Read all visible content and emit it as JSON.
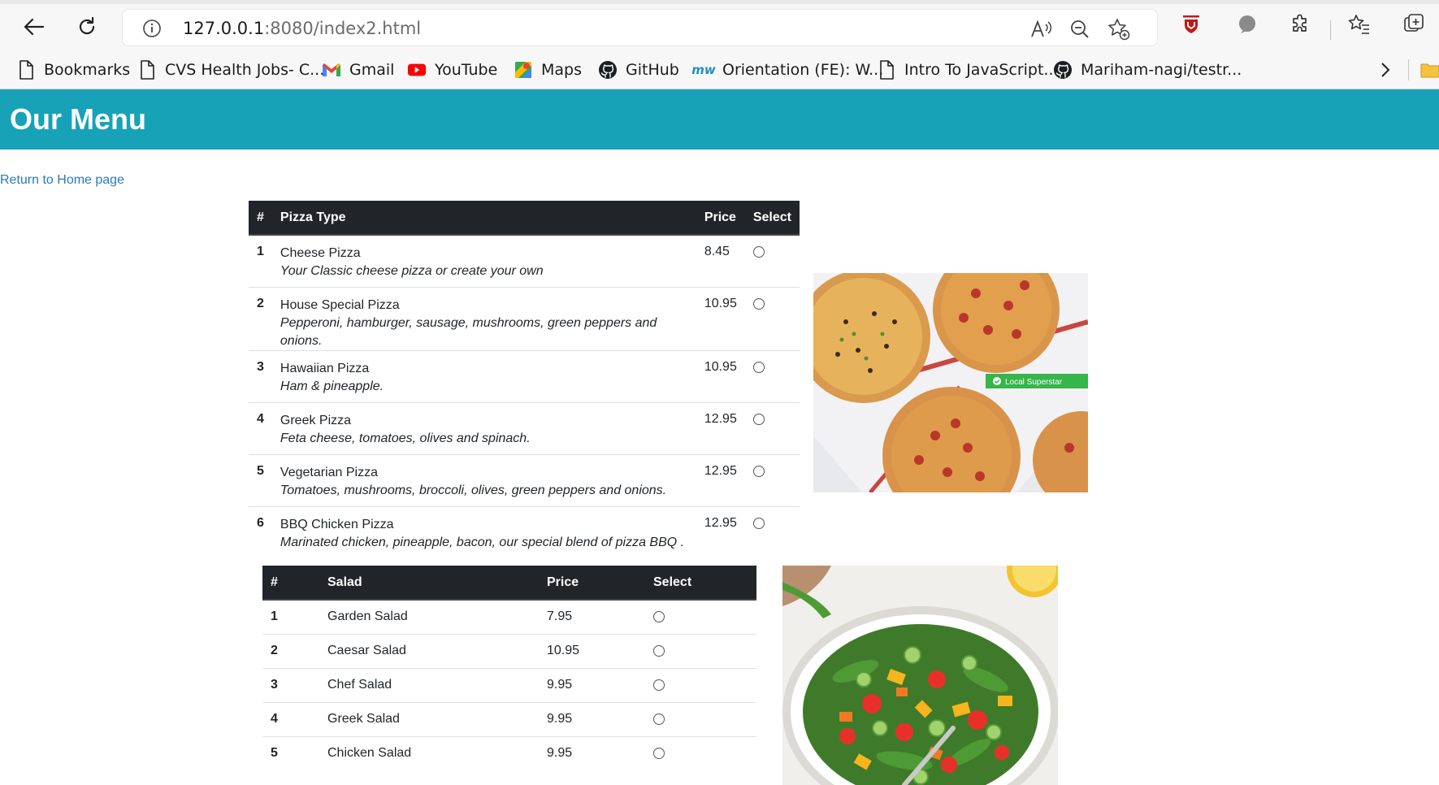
{
  "browser": {
    "url_host": "127.0.0.1",
    "url_rest": ":8080/index2.html",
    "bookmarks": [
      {
        "label": "Bookmarks",
        "icon": "page-icon"
      },
      {
        "label": "CVS Health Jobs- C...",
        "icon": "page-icon"
      },
      {
        "label": "Gmail",
        "icon": "gmail-icon"
      },
      {
        "label": "YouTube",
        "icon": "youtube-icon"
      },
      {
        "label": "Maps",
        "icon": "maps-icon"
      },
      {
        "label": "GitHub",
        "icon": "github-icon"
      },
      {
        "label": "Orientation (FE): W...",
        "icon": "mw-icon"
      },
      {
        "label": "Intro To JavaScript...",
        "icon": "page-icon"
      },
      {
        "label": "Mariham-nagi/testr...",
        "icon": "github-icon"
      }
    ],
    "mw_icon_text": "mw"
  },
  "page": {
    "title": "Our Menu",
    "home_link": "Return to Home page",
    "accent_color": "#17a2b8",
    "pizza_table": {
      "headers": [
        "#",
        "Pizza Type",
        "Price",
        "Select"
      ],
      "rows": [
        {
          "num": "1",
          "name": "Cheese Pizza",
          "desc": "Your Classic cheese pizza or create your own",
          "price": "8.45"
        },
        {
          "num": "2",
          "name": "House Special Pizza",
          "desc": "Pepperoni, hamburger, sausage, mushrooms, green peppers and onions.",
          "price": "10.95"
        },
        {
          "num": "3",
          "name": "Hawaiian Pizza",
          "desc": "Ham & pineapple.",
          "price": "10.95"
        },
        {
          "num": "4",
          "name": "Greek Pizza",
          "desc": "Feta cheese, tomatoes, olives and spinach.",
          "price": "12.95"
        },
        {
          "num": "5",
          "name": "Vegetarian Pizza",
          "desc": "Tomatoes, mushrooms, broccoli, olives, green peppers and onions.",
          "price": "12.95"
        },
        {
          "num": "6",
          "name": "BBQ Chicken Pizza",
          "desc": "Marinated chicken, pineapple, bacon, our special blend of pizza BBQ .",
          "price": "12.95"
        }
      ]
    },
    "pizza_image": {
      "badge": "Local Superstar"
    },
    "salad_table": {
      "headers": [
        "#",
        "Salad",
        "Price",
        "Select"
      ],
      "rows": [
        {
          "num": "1",
          "name": "Garden Salad",
          "price": "7.95"
        },
        {
          "num": "2",
          "name": "Caesar Salad",
          "price": "10.95"
        },
        {
          "num": "3",
          "name": "Chef Salad",
          "price": "9.95"
        },
        {
          "num": "4",
          "name": "Greek Salad",
          "price": "9.95"
        },
        {
          "num": "5",
          "name": "Chicken Salad",
          "price": "9.95"
        }
      ]
    }
  }
}
